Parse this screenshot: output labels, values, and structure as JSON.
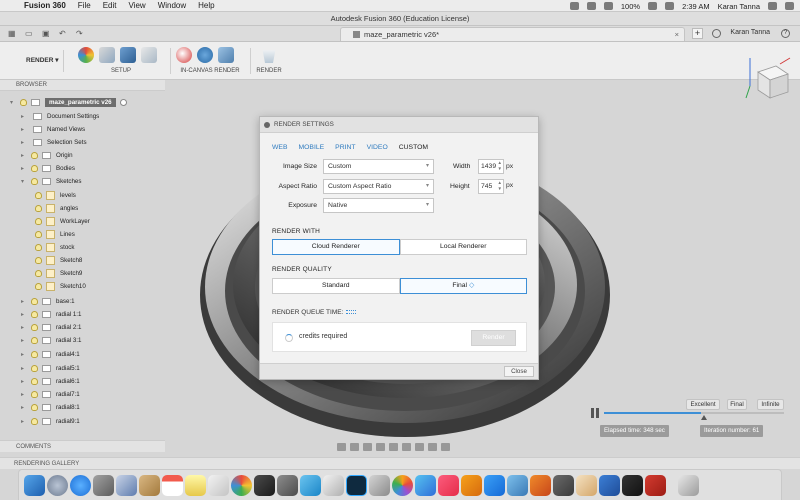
{
  "menubar": {
    "app_name": "Fusion 360",
    "menus": [
      "File",
      "Edit",
      "View",
      "Window",
      "Help"
    ],
    "battery": "100%",
    "time": "2:39 AM",
    "user": "Karan Tanna"
  },
  "window": {
    "title": "Autodesk Fusion 360 (Education License)"
  },
  "tabs": {
    "document_tab": "maze_parametric v26*",
    "user": "Karan Tanna"
  },
  "toolbar": {
    "workspace": "RENDER",
    "groups": [
      "SETUP",
      "IN-CANVAS RENDER",
      "RENDER"
    ]
  },
  "browser": {
    "header": "BROWSER",
    "root": "maze_parametric v26",
    "items": {
      "document_settings": "Document Settings",
      "named_views": "Named Views",
      "selection_sets": "Selection Sets",
      "origin": "Origin",
      "bodies": "Bodies",
      "sketches": "Sketches",
      "sketch_levels": "levels",
      "sketch_angles": "angles",
      "sketch_worklayer": "WorkLayer",
      "sketch_lines": "Lines",
      "sketch_stock": "stock",
      "sketch8": "Sketch8",
      "sketch9": "Sketch9",
      "sketch10": "Sketch10",
      "comp_base": "base:1",
      "comp_radial1": "radial 1:1",
      "comp_radial2": "radial 2:1",
      "comp_radial3": "radial 3:1",
      "comp_radial4": "radial4:1",
      "comp_radial5": "radial5:1",
      "comp_radial6": "radial6:1",
      "comp_radial7": "radial7:1",
      "comp_radial8": "radial8:1",
      "comp_radial9": "radial9:1"
    }
  },
  "dialog": {
    "title": "RENDER SETTINGS",
    "tabs": [
      "WEB",
      "MOBILE",
      "PRINT",
      "VIDEO",
      "CUSTOM"
    ],
    "image_size_label": "Image Size",
    "image_size_value": "Custom",
    "aspect_ratio_label": "Aspect Ratio",
    "aspect_ratio_value": "Custom Aspect Ratio",
    "exposure_label": "Exposure",
    "exposure_value": "Native",
    "width_label": "Width",
    "width_value": "1439",
    "height_label": "Height",
    "height_value": "745",
    "unit": "px",
    "render_with_label": "RENDER WITH",
    "cloud_renderer": "Cloud Renderer",
    "local_renderer": "Local Renderer",
    "render_quality_label": "RENDER QUALITY",
    "quality_standard": "Standard",
    "quality_final": "Final",
    "queue_time_label": "RENDER QUEUE TIME:",
    "credits_text": "credits required",
    "render_button": "Render",
    "close_button": "Close"
  },
  "render_progress": {
    "quality_levels": [
      "Excellent",
      "Final",
      "Infinite"
    ],
    "progress": 0.54,
    "elapsed": "Elapsed time: 348 sec",
    "iteration": "Iteration number: 61"
  },
  "bottom": {
    "comments": "COMMENTS",
    "gallery": "RENDERING GALLERY"
  },
  "colors": {
    "accent": "#3d8fd6",
    "root_node": "#6d6d6d",
    "link": "#2f7bbf"
  }
}
